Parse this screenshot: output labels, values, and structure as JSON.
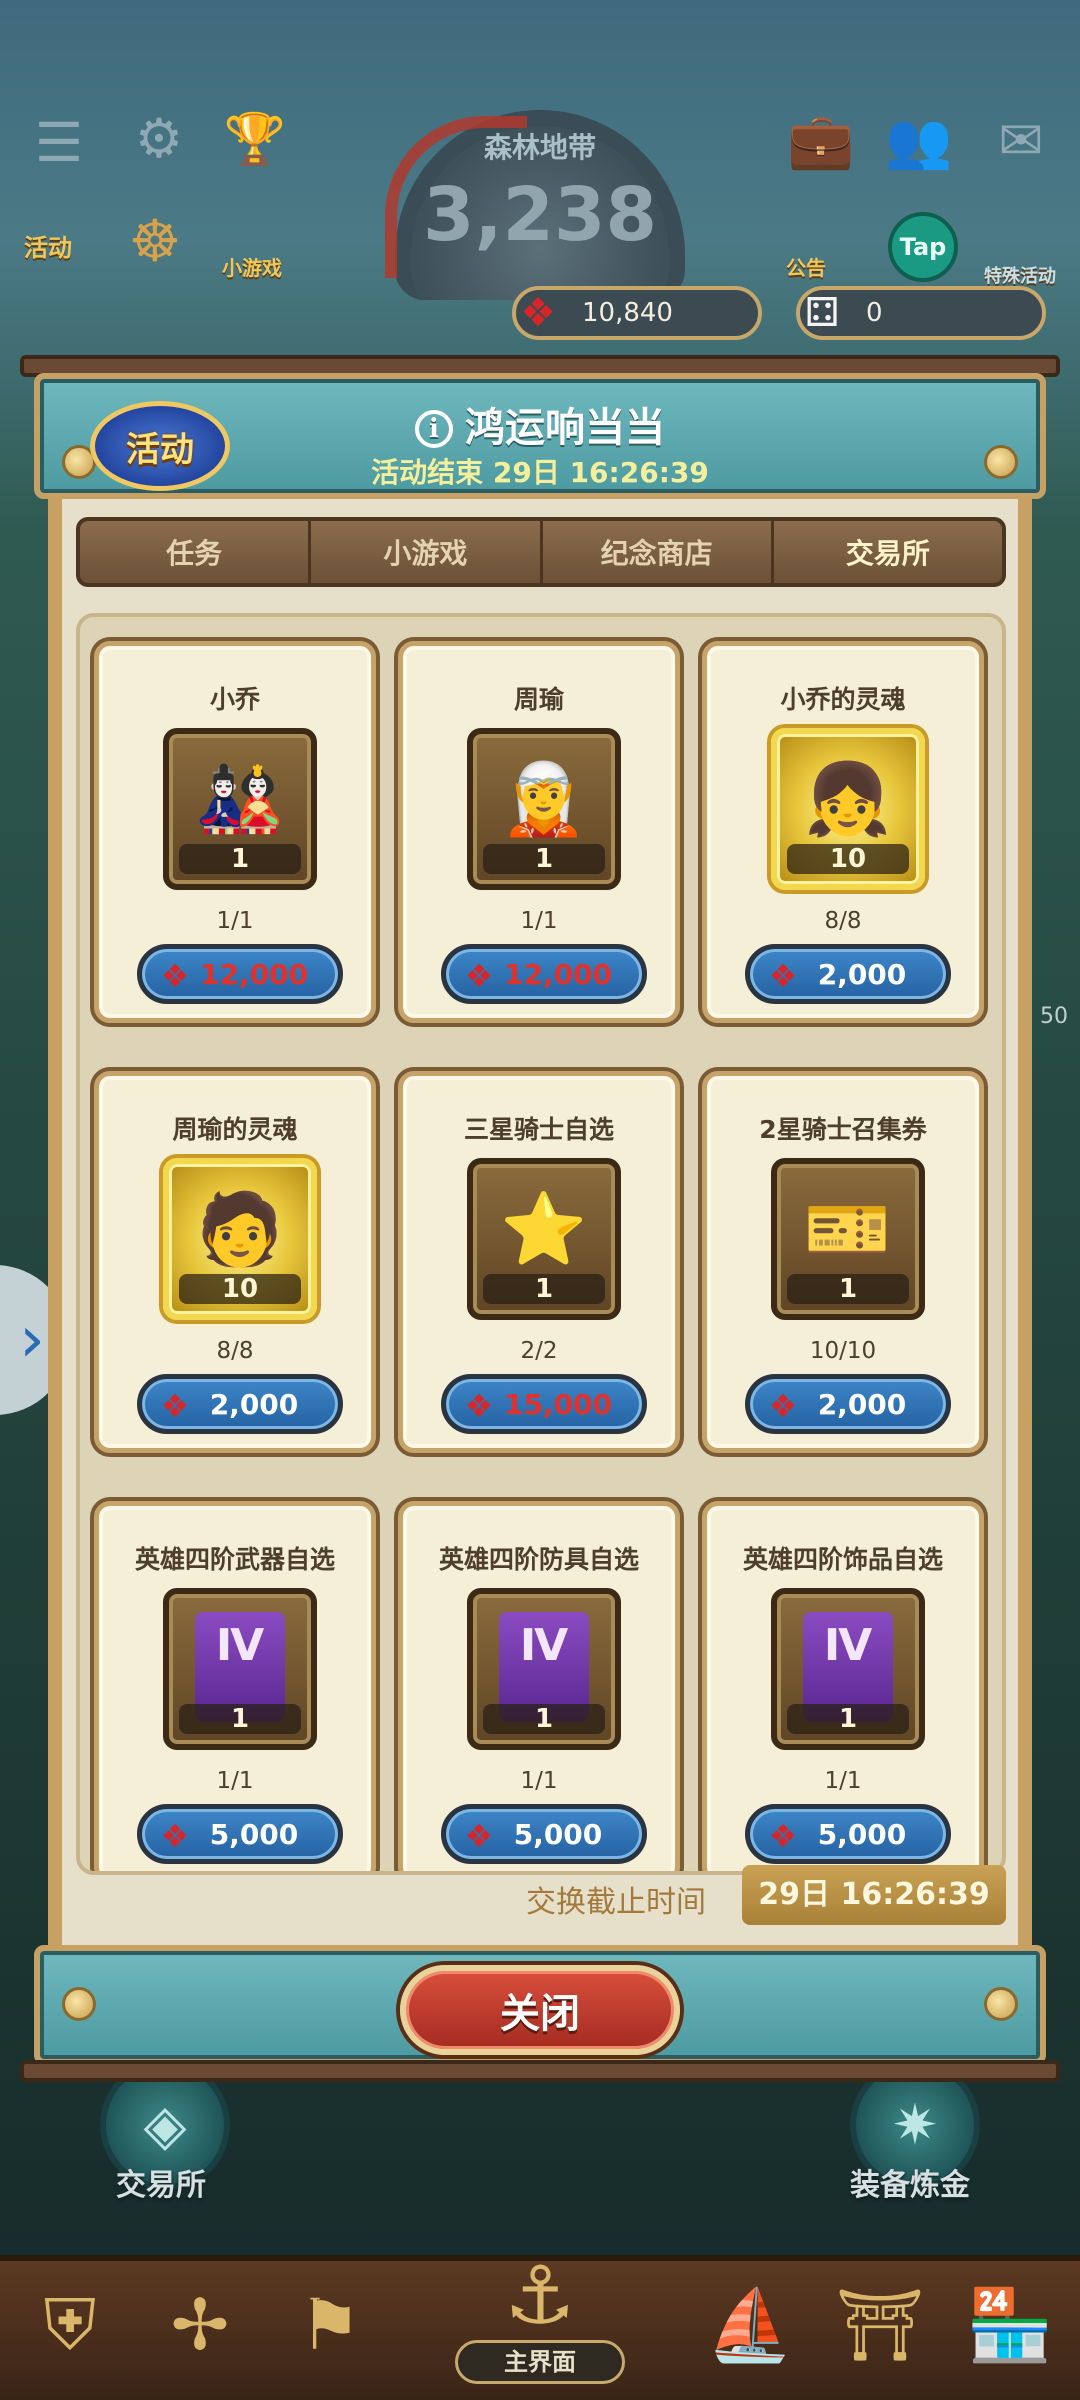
{
  "hud": {
    "zone_name": "森林地带",
    "zone_value": "3,238",
    "activity_label": "活动",
    "minigame_label": "小游戏",
    "notice_label": "公告",
    "tap_label": "Tap",
    "special_label": "特殊活动",
    "currency_knot": "10,840",
    "currency_dice": "0"
  },
  "background": {
    "left_circle_label": "交易所",
    "right_circle_label": "装备炼金",
    "side_number": "50",
    "home_label": "主界面"
  },
  "modal": {
    "badge_label": "活动",
    "title": "鸿运响当当",
    "subtitle": "活动结束 29日 16:26:39",
    "tabs": [
      {
        "label": "任务",
        "active": false
      },
      {
        "label": "小游戏",
        "active": false
      },
      {
        "label": "纪念商店",
        "active": false
      },
      {
        "label": "交易所",
        "active": true
      }
    ],
    "items": [
      {
        "name": "小乔",
        "count": "1",
        "stock": "1/1",
        "price": "12,000",
        "insufficient": true,
        "art": "🎎",
        "gold": false
      },
      {
        "name": "周瑜",
        "count": "1",
        "stock": "1/1",
        "price": "12,000",
        "insufficient": true,
        "art": "🧝",
        "gold": false
      },
      {
        "name": "小乔的灵魂",
        "count": "10",
        "stock": "8/8",
        "price": "2,000",
        "insufficient": false,
        "art": "👧",
        "gold": true
      },
      {
        "name": "周瑜的灵魂",
        "count": "10",
        "stock": "8/8",
        "price": "2,000",
        "insufficient": false,
        "art": "🧑",
        "gold": true
      },
      {
        "name": "三星骑士自选",
        "count": "1",
        "stock": "2/2",
        "price": "15,000",
        "insufficient": true,
        "art": "⭐",
        "gold": false
      },
      {
        "name": "2星骑士召集券",
        "count": "1",
        "stock": "10/10",
        "price": "2,000",
        "insufficient": false,
        "art": "🎫",
        "gold": false
      },
      {
        "name": "英雄四阶武器自选",
        "count": "1",
        "stock": "1/1",
        "price": "5,000",
        "insufficient": false,
        "art": "Ⅳ",
        "gold": false
      },
      {
        "name": "英雄四阶防具自选",
        "count": "1",
        "stock": "1/1",
        "price": "5,000",
        "insufficient": false,
        "art": "Ⅳ",
        "gold": false
      },
      {
        "name": "英雄四阶饰品自选",
        "count": "1",
        "stock": "1/1",
        "price": "5,000",
        "insufficient": false,
        "art": "Ⅳ",
        "gold": false
      }
    ],
    "deadline_label": "交换截止时间",
    "deadline_value": "29日 16:26:39",
    "close_label": "关闭"
  }
}
